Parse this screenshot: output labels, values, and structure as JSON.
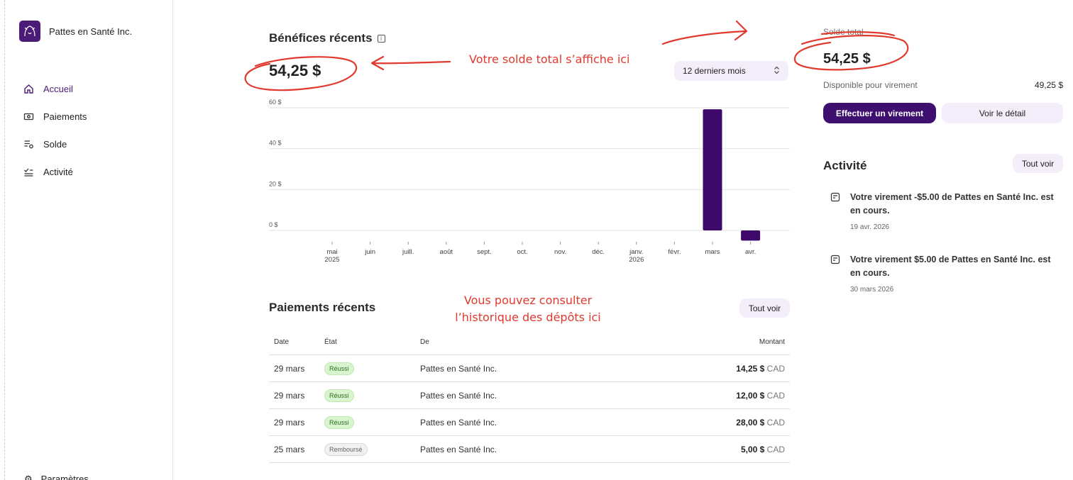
{
  "brand": {
    "name": "Pattes en Santé Inc.",
    "logo_icon": "paw-dog-logo",
    "logo_color": "#4b1b77"
  },
  "sidebar": {
    "items": [
      {
        "label": "Accueil",
        "icon": "home-icon",
        "active": true
      },
      {
        "label": "Paiements",
        "icon": "payments-icon",
        "active": false
      },
      {
        "label": "Solde",
        "icon": "balance-icon",
        "active": false
      },
      {
        "label": "Activité",
        "icon": "activity-icon",
        "active": false
      }
    ],
    "bottom_label": "Paramètres"
  },
  "earnings": {
    "title": "Bénéfices récents",
    "total": "54,25 $",
    "range": "12 derniers mois"
  },
  "chart_data": {
    "type": "bar",
    "categories": [
      "mai 2025",
      "juin",
      "juill.",
      "août",
      "sept.",
      "oct.",
      "nov.",
      "déc.",
      "janv. 2026",
      "févr.",
      "mars",
      "avr."
    ],
    "values": [
      0,
      0,
      0,
      0,
      0,
      0,
      0,
      0,
      0,
      0,
      59.25,
      -5
    ],
    "ylim": [
      -5,
      60
    ],
    "yticks": [
      "0 $",
      "20 $",
      "40 $",
      "60 $"
    ],
    "grid": true,
    "bar_color": "#3d0a6b"
  },
  "payments": {
    "title": "Paiements récents",
    "see_all": "Tout voir",
    "headers": {
      "date": "Date",
      "state": "État",
      "from": "De",
      "amount": "Montant"
    },
    "rows": [
      {
        "date": "29 mars",
        "state": "Réussi",
        "status": "ok",
        "from": "Pattes en Santé Inc.",
        "amount": "14,25 $",
        "currency": "CAD"
      },
      {
        "date": "29 mars",
        "state": "Réussi",
        "status": "ok",
        "from": "Pattes en Santé Inc.",
        "amount": "12,00 $",
        "currency": "CAD"
      },
      {
        "date": "29 mars",
        "state": "Réussi",
        "status": "ok",
        "from": "Pattes en Santé Inc.",
        "amount": "28,00 $",
        "currency": "CAD"
      },
      {
        "date": "25 mars",
        "state": "Remboursé",
        "status": "ref",
        "from": "Pattes en Santé Inc.",
        "amount": "5,00 $",
        "currency": "CAD"
      }
    ]
  },
  "balance": {
    "label": "Solde total",
    "amount": "54,25 $",
    "available_label": "Disponible pour virement",
    "available_value": "49,25 $",
    "transfer_button": "Effectuer un virement",
    "detail_button": "Voir le détail"
  },
  "activity": {
    "title": "Activité",
    "see_all": "Tout voir",
    "items": [
      {
        "text": "Votre virement -$5.00 de Pattes en Santé Inc. est en cours.",
        "date": "19 avr. 2026"
      },
      {
        "text": "Votre virement $5.00 de Pattes en Santé Inc. est en cours.",
        "date": "30 mars 2026"
      }
    ]
  },
  "annotations": {
    "solde_note": "Votre solde total s’affiche ici",
    "history_note_line1": "Vous pouvez consulter",
    "history_note_line2": "l’historique des dépôts ici",
    "color": "#e03a2e"
  }
}
